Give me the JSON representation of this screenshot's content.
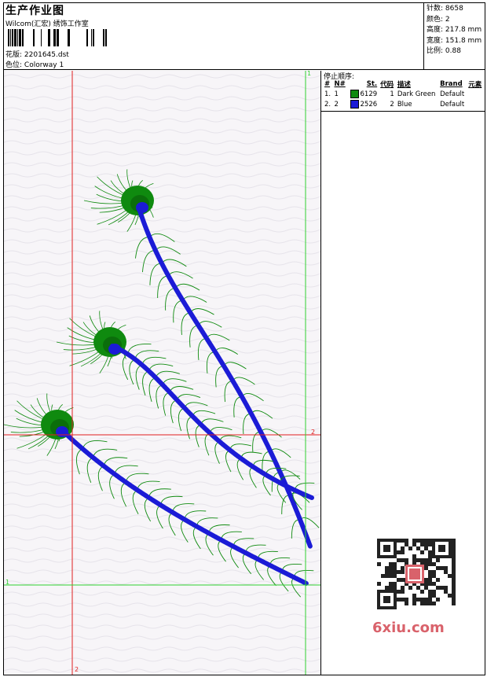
{
  "header": {
    "title": "生产作业图",
    "company": "Wilcom(汇宏) 绣饰工作室",
    "design_label": "花版:",
    "design_value": "2201645.dst",
    "colorway_label": "色位:",
    "colorway_value": "Colorway 1"
  },
  "stats": [
    {
      "label": "针数:",
      "value": "8658"
    },
    {
      "label": "颜色:",
      "value": "2"
    },
    {
      "label": "高度:",
      "value": "217.8 mm"
    },
    {
      "label": "宽度:",
      "value": "151.8 mm"
    },
    {
      "label": "比例:",
      "value": "0.88"
    }
  ],
  "stops": {
    "title": "停止顺序:",
    "columns": [
      "#",
      "N#",
      "St.",
      "代码",
      "描述",
      "Brand",
      "元素"
    ],
    "rows": [
      {
        "index": "1.",
        "needle": "1",
        "color": "#0f8a0f",
        "stitches": "6129",
        "code": "1",
        "description": "Dark Green",
        "brand": "Default"
      },
      {
        "index": "2.",
        "needle": "2",
        "color": "#1b1bd6",
        "stitches": "2526",
        "code": "2",
        "description": "Blue",
        "brand": "Default"
      }
    ]
  },
  "guides": {
    "green_label_top": "1",
    "green_label_left": "1",
    "red_label_right": "2",
    "red_label_bottom": "2"
  },
  "watermark": {
    "brand": "6xiu.com"
  },
  "colors": {
    "green": "#0f8a0f",
    "blue": "#1b1bd6",
    "guide_green": "#2fd12f",
    "guide_red": "#e02020"
  }
}
